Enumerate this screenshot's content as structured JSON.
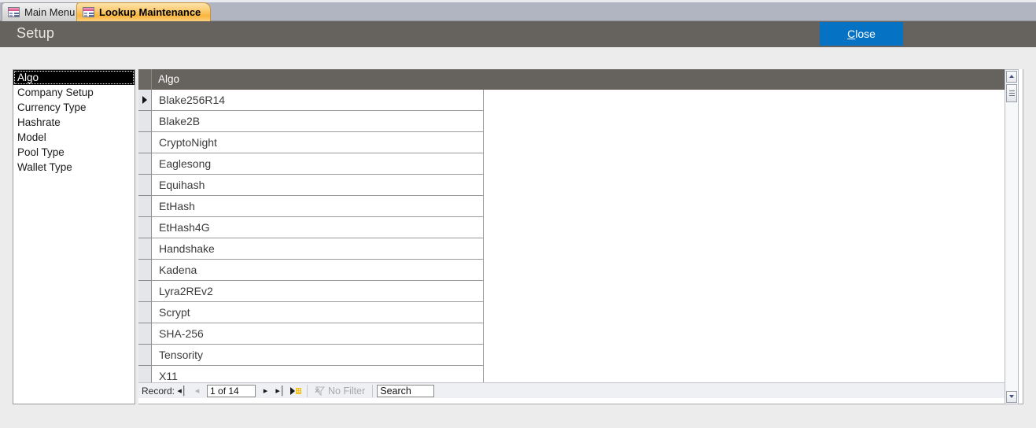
{
  "window": {
    "tabs": [
      {
        "label": "Main Menu",
        "icon": "access-form-icon",
        "active": false
      },
      {
        "label": "Lookup Maintenance",
        "icon": "access-form-icon",
        "active": true
      }
    ]
  },
  "header": {
    "title": "Setup",
    "close_label": "Close",
    "close_accel": "C",
    "close_rest": "lose",
    "accent_color": "#0672c4",
    "band_color": "#66625d"
  },
  "category_list": {
    "selected": "Algo",
    "items": [
      {
        "label": "Algo"
      },
      {
        "label": "Company Setup"
      },
      {
        "label": "Currency Type"
      },
      {
        "label": "Hashrate"
      },
      {
        "label": "Model"
      },
      {
        "label": "Pool Type"
      },
      {
        "label": "Wallet Type"
      }
    ]
  },
  "datasheet": {
    "column_header": "Algo",
    "current_row_index": 0,
    "rows": [
      {
        "value": "Blake256R14"
      },
      {
        "value": "Blake2B"
      },
      {
        "value": "CryptoNight"
      },
      {
        "value": "Eaglesong"
      },
      {
        "value": "Equihash"
      },
      {
        "value": "EtHash"
      },
      {
        "value": "EtHash4G"
      },
      {
        "value": "Handshake"
      },
      {
        "value": "Kadena"
      },
      {
        "value": "Lyra2REv2"
      },
      {
        "value": "Scrypt"
      },
      {
        "value": "SHA-256"
      },
      {
        "value": "Tensority"
      },
      {
        "value": "X11"
      }
    ]
  },
  "navigator": {
    "record_label": "Record:",
    "position": "1 of 14",
    "first_icon": "first-record-icon",
    "previous_icon": "previous-record-icon",
    "next_icon": "next-record-icon",
    "last_icon": "last-record-icon",
    "new_icon": "new-record-icon",
    "filter_label": "No Filter",
    "filter_icon": "filter-icon",
    "search_placeholder": "Search",
    "search_value": "Search"
  },
  "scrollbar": {
    "up_icon": "scroll-up-icon",
    "down_icon": "scroll-down-icon",
    "thumb": "scroll-thumb"
  }
}
